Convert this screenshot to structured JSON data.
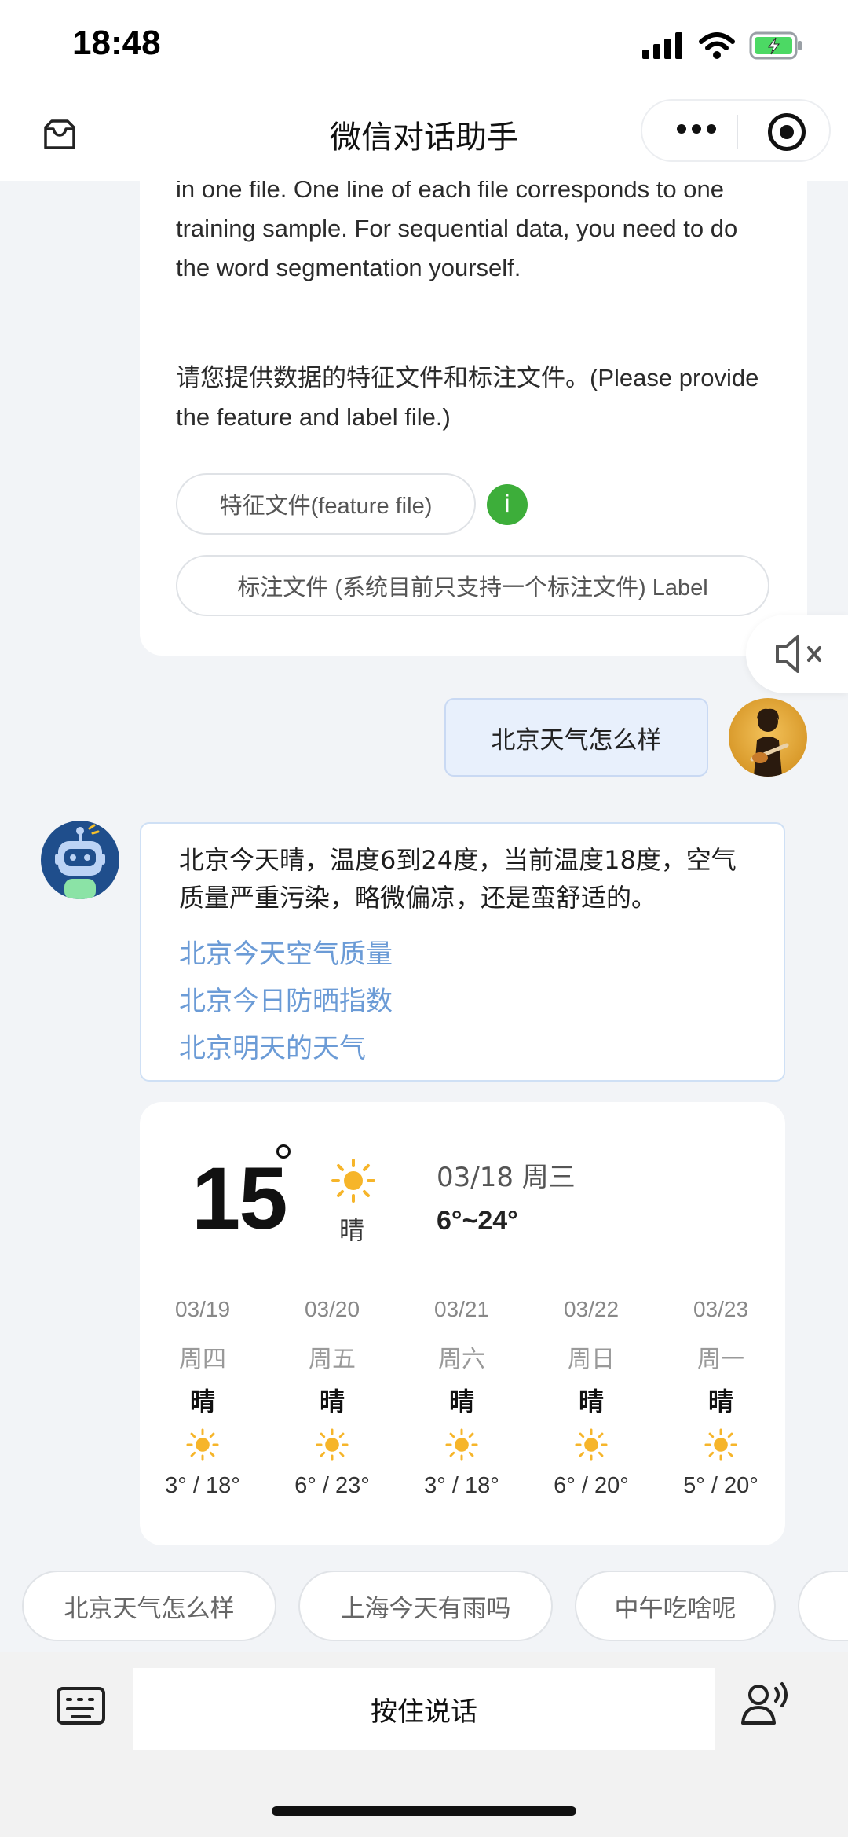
{
  "status_bar": {
    "time": "18:48",
    "icons": [
      "signal-icon",
      "wifi-icon",
      "battery-charging-icon"
    ]
  },
  "nav": {
    "title": "微信对话助手",
    "left_icon": "inbox-icon",
    "capsule_icons": [
      "more-dots-icon",
      "record-target-icon"
    ]
  },
  "chat": {
    "prev_card": {
      "text_partial": "are multiple features, each feature needs to be stored in one file. One line of each file corresponds to one training sample. For sequential data, you need to do the word segmentation yourself.",
      "prompt": "请您提供数据的特征文件和标注文件。(Please provide the feature and label file.)",
      "option1": "特征文件(feature file)",
      "info_badge": "i",
      "option2": "标注文件 (系统目前只支持一个标注文件) Label"
    },
    "mute_icon": "speaker-muted-icon",
    "user_message": "北京天气怎么样",
    "bot_reply": {
      "text": "北京今天晴，温度6到24度，当前温度18度，空气质量严重污染，略微偏凉，还是蛮舒适的。",
      "links": [
        "北京今天空气质量",
        "北京今日防晒指数",
        "北京明天的天气"
      ]
    },
    "weather": {
      "current_temp": "15",
      "condition": "晴",
      "date": "03/18 周三",
      "range": "6°~24°",
      "forecast": [
        {
          "date": "03/19",
          "weekday": "周四",
          "cond": "晴",
          "range": "3° / 18°"
        },
        {
          "date": "03/20",
          "weekday": "周五",
          "cond": "晴",
          "range": "6° / 23°"
        },
        {
          "date": "03/21",
          "weekday": "周六",
          "cond": "晴",
          "range": "3° / 18°"
        },
        {
          "date": "03/22",
          "weekday": "周日",
          "cond": "晴",
          "range": "6° / 20°"
        },
        {
          "date": "03/23",
          "weekday": "周一",
          "cond": "晴",
          "range": "5° / 20°"
        }
      ]
    }
  },
  "suggestions": [
    "北京天气怎么样",
    "上海今天有雨吗",
    "中午吃啥呢",
    ""
  ],
  "input_bar": {
    "hold_to_talk": "按住说话",
    "left_icon": "keyboard-icon",
    "right_icon": "voice-person-icon"
  },
  "colors": {
    "link": "#6b9bd6",
    "sun": "#f6b52a",
    "bubble_user": "#e8f0fc",
    "info_green": "#3dae3a"
  }
}
